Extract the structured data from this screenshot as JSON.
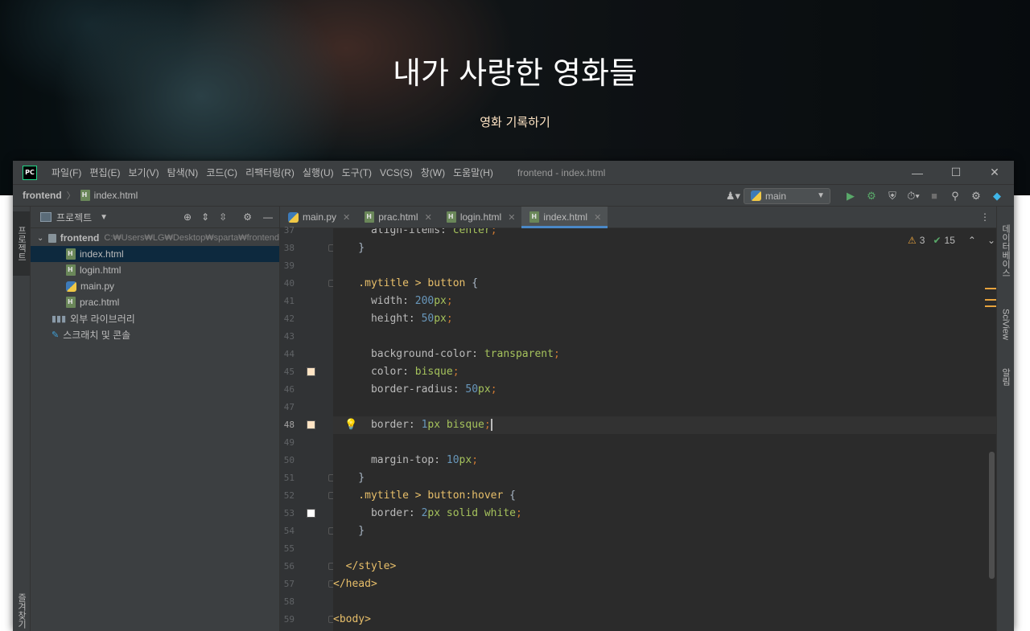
{
  "web_page": {
    "title": "내가 사랑한 영화들",
    "button_label": "영화 기록하기"
  },
  "ide": {
    "window_title": "frontend - index.html",
    "menu": [
      "파일(F)",
      "편집(E)",
      "보기(V)",
      "탐색(N)",
      "코드(C)",
      "리팩터링(R)",
      "실행(U)",
      "도구(T)",
      "VCS(S)",
      "창(W)",
      "도움말(H)"
    ],
    "breadcrumb": {
      "project": "frontend",
      "file": "index.html"
    },
    "run_config": "main",
    "left_strip": {
      "project_tab": "프로젝트",
      "bottom_tab": "즐겨찾기"
    },
    "right_strip": {
      "database_tab": "데이터베이스",
      "sciview_tab": "SciView",
      "notifications_tab": "알림"
    },
    "project_panel": {
      "header": "프로젝트",
      "root": "frontend",
      "root_path": "C:₩Users₩LG₩Desktop₩sparta₩frontend",
      "files": [
        "index.html",
        "login.html",
        "main.py",
        "prac.html"
      ],
      "external_libraries": "외부 라이브러리",
      "scratches": "스크래치 및 콘솔"
    },
    "tabs": [
      {
        "label": "main.py",
        "type": "py"
      },
      {
        "label": "prac.html",
        "type": "html"
      },
      {
        "label": "login.html",
        "type": "html"
      },
      {
        "label": "index.html",
        "type": "html",
        "active": true
      }
    ],
    "inspections": {
      "warnings": "3",
      "ok": "15"
    },
    "code": [
      {
        "n": "37",
        "text": "      align-items: center;"
      },
      {
        "n": "38",
        "text": "    }"
      },
      {
        "n": "39",
        "text": ""
      },
      {
        "n": "40",
        "text": "    .mytitle > button {"
      },
      {
        "n": "41",
        "text": "      width: 200px;"
      },
      {
        "n": "42",
        "text": "      height: 50px;"
      },
      {
        "n": "43",
        "text": ""
      },
      {
        "n": "44",
        "text": "      background-color: transparent;"
      },
      {
        "n": "45",
        "text": "      color: bisque;"
      },
      {
        "n": "46",
        "text": "      border-radius: 50px;"
      },
      {
        "n": "47",
        "text": ""
      },
      {
        "n": "48",
        "text": "      border: 1px bisque;"
      },
      {
        "n": "49",
        "text": ""
      },
      {
        "n": "50",
        "text": "      margin-top: 10px;"
      },
      {
        "n": "51",
        "text": "    }"
      },
      {
        "n": "52",
        "text": "    .mytitle > button:hover {"
      },
      {
        "n": "53",
        "text": "      border: 2px solid white;"
      },
      {
        "n": "54",
        "text": "    }"
      },
      {
        "n": "55",
        "text": ""
      },
      {
        "n": "56",
        "text": "  </style>"
      },
      {
        "n": "57",
        "text": "</head>"
      },
      {
        "n": "58",
        "text": ""
      },
      {
        "n": "59",
        "text": "<body>"
      }
    ],
    "colors": {
      "accent": "#4a88c7",
      "bisque": "#ffe4c4",
      "white": "#ffffff",
      "selected_row": "#0d293e"
    }
  }
}
